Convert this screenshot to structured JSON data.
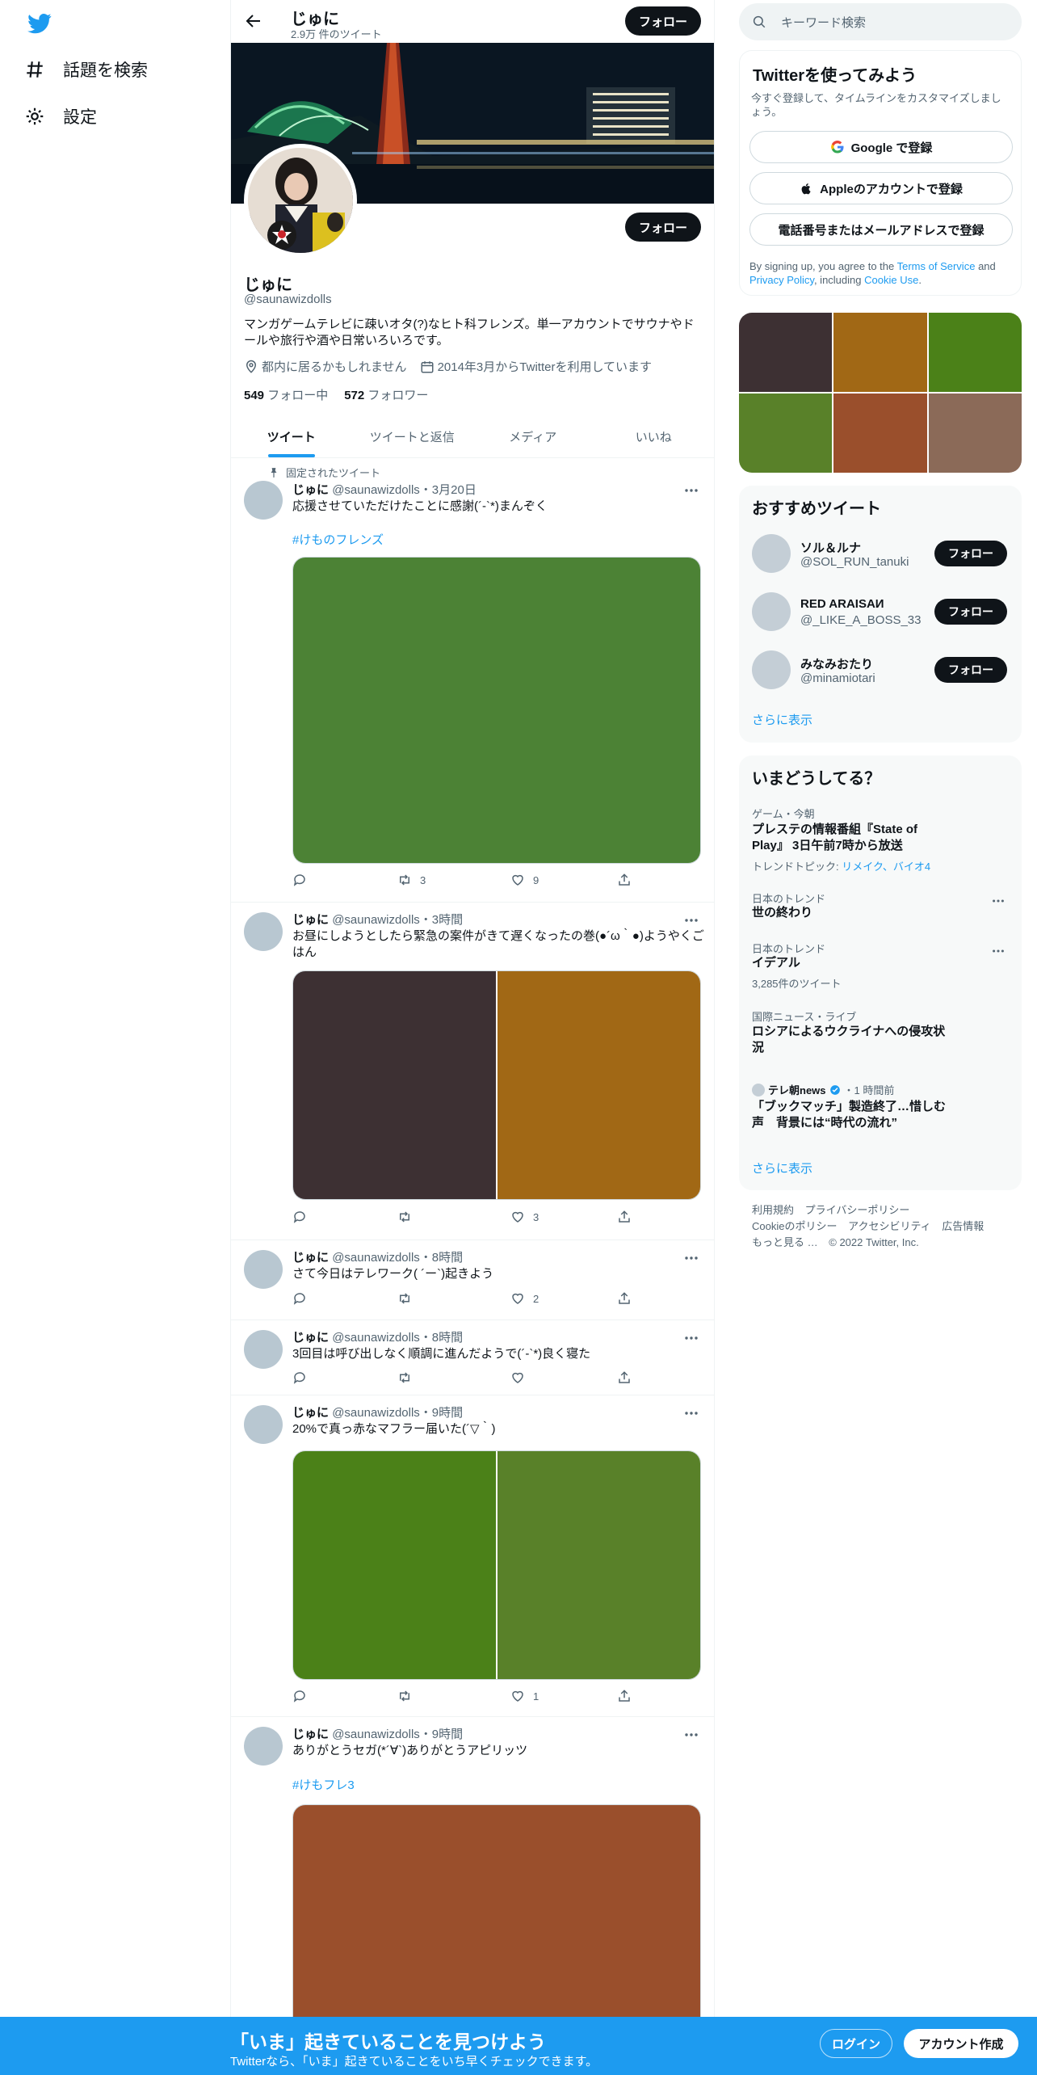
{
  "nav": {
    "items": [
      {
        "label": "話題を検索",
        "icon": "hashtag-icon"
      },
      {
        "label": "設定",
        "icon": "gear-icon"
      }
    ]
  },
  "profile": {
    "name": "じゅに",
    "tweet_count": "2.9万 件のツイート",
    "follow_label": "フォロー",
    "handle": "@saunawizdolls",
    "bio": "マンガゲームテレビに疎いオタ(?)なヒト科フレンズ。単一アカウントでサウナやドールや旅行や酒や日常いろいろです。",
    "location": "都内に居るかもしれません",
    "joined": "2014年3月からTwitterを利用しています",
    "following_count": "549",
    "following_label": "フォロー中",
    "followers_count": "572",
    "followers_label": "フォロワー"
  },
  "tabs": [
    "ツイート",
    "ツイートと返信",
    "メディア",
    "いいね"
  ],
  "pinned_label": "固定されたツイート",
  "tweets": [
    {
      "name": "じゅに",
      "meta": "@saunawizdolls・3月20日",
      "text": "応援させていただけたことに感謝(´-`*)まんぞく",
      "tag": "#けものフレンズ",
      "retweets": "3",
      "likes": "9",
      "media_colors": [
        "#4c8235"
      ]
    },
    {
      "name": "じゅに",
      "meta": "@saunawizdolls・3時間",
      "text": "お昼にしようとしたら緊急の案件がきて遅くなったの巻(●´ω｀●)ようやくごはん",
      "retweets": "",
      "likes": "3",
      "media_colors": [
        "#3d3033",
        "#a16815"
      ]
    },
    {
      "name": "じゅに",
      "meta": "@saunawizdolls・8時間",
      "text": "さて今日はテレワーク( ´ー`)起きよう",
      "retweets": "",
      "likes": "2"
    },
    {
      "name": "じゅに",
      "meta": "@saunawizdolls・8時間",
      "text": "3回目は呼び出しなく順調に進んだようで(´-`*)良く寝た",
      "retweets": "",
      "likes": ""
    },
    {
      "name": "じゅに",
      "meta": "@saunawizdolls・9時間",
      "text": "20%で真っ赤なマフラー届いた(´▽｀)",
      "retweets": "",
      "likes": "1",
      "media_colors": [
        "#4b8118",
        "#598129"
      ]
    },
    {
      "name": "じゅに",
      "meta": "@saunawizdolls・9時間",
      "text": "ありがとうセガ(*´∀`)ありがとうアピリッツ",
      "tag": "#けもフレ3",
      "media_colors": [
        "#9a4f2c"
      ]
    }
  ],
  "search": {
    "placeholder": "キーワード検索"
  },
  "signup": {
    "title": "Twitterを使ってみよう",
    "subtitle": "今すぐ登録して、タイムラインをカスタマイズしましょう。",
    "google": "Google で登録",
    "apple": "Appleのアカウントで登録",
    "phone": "電話番号またはメールアドレスで登録",
    "legal_1": "By signing up, you agree to the",
    "tos": "Terms of Service",
    "and": "and",
    "privacy": "Privacy Policy",
    "including": ", including",
    "cookie": "Cookie Use",
    "period": "."
  },
  "media_grid": [
    "#3d3033",
    "#a16815",
    "#4b8118",
    "#598129",
    "#9a4f2c",
    "#8b6a58"
  ],
  "who_to_follow": {
    "title": "おすすめツイート",
    "accounts": [
      {
        "name": "ソル＆ルナ",
        "handle": "@SOL_RUN_tanuki"
      },
      {
        "name": "RED ARAISAИ",
        "handle": "@_LIKE_A_BOSS_33"
      },
      {
        "name": "みなみおたり",
        "handle": "@minamiotari"
      }
    ],
    "follow_label": "フォロー",
    "more": "さらに表示"
  },
  "trends": {
    "title": "いまどうしてる？",
    "items": [
      {
        "context": "ゲーム・今朝",
        "name": "プレステの情報番組『State of Play』 3日午前7時から放送",
        "sub_prefix": "トレンドトピック:",
        "sub_links": "リメイク、バイオ4"
      },
      {
        "context": "日本のトレンド",
        "name": "世の終わり"
      },
      {
        "context": "日本のトレンド",
        "name": "イデアル",
        "sub": "3,285件のツイート"
      },
      {
        "context": "国際ニュース・ライブ",
        "name": "ロシアによるウクライナへの侵攻状況"
      },
      {
        "source": "テレ朝news",
        "time": "・1 時間前",
        "name": "「ブックマッチ」製造終了…惜しむ声　背景には“時代の流れ”"
      }
    ],
    "more": "さらに表示"
  },
  "footer": {
    "links": [
      "利用規約",
      "プライバシーポリシー",
      "Cookieのポリシー",
      "アクセシビリティ",
      "広告情報",
      "もっと見る …",
      "© 2022 Twitter, Inc."
    ]
  },
  "bottom_bar": {
    "title": "「いま」起きていることを見つけよう",
    "subtitle": "Twitterなら、「いま」起きていることをいち早くチェックできます。",
    "login": "ログイン",
    "signup": "アカウント作成"
  },
  "colors": {
    "accent": "#1d9bf0",
    "dark": "#0f1419",
    "muted": "#536471"
  }
}
